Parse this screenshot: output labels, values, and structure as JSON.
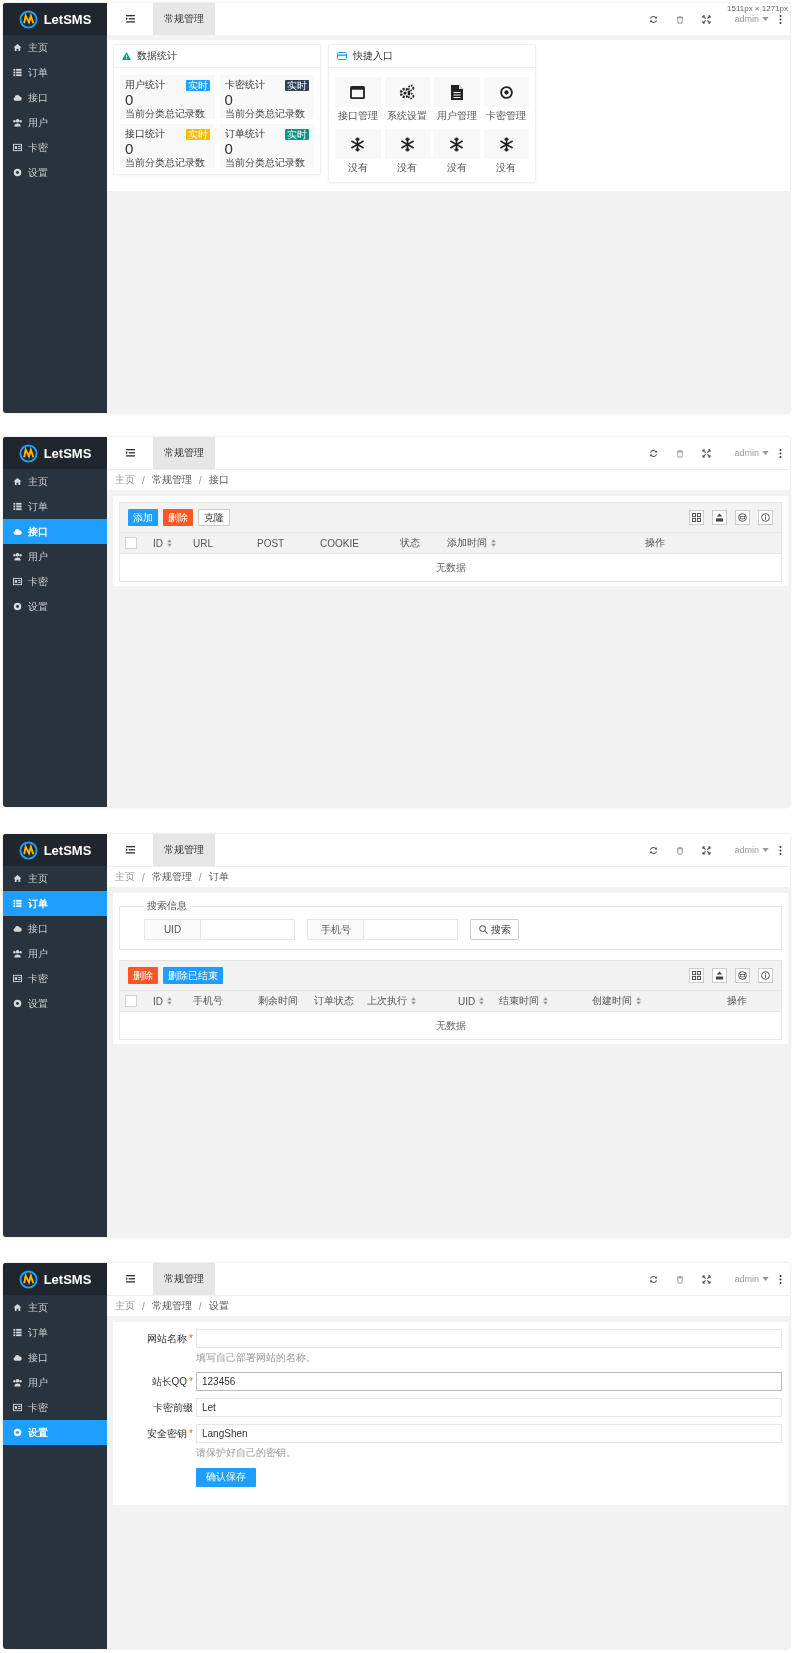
{
  "screens": [
    {
      "kind": "dashboard",
      "brand": "LetSMS",
      "size_label": "1511px × 1271px",
      "nav": [
        {
          "label": "主页",
          "selected": false
        },
        {
          "label": "订单",
          "selected": false
        },
        {
          "label": "接口",
          "selected": false
        },
        {
          "label": "用户",
          "selected": false
        },
        {
          "label": "卡密",
          "selected": false
        },
        {
          "label": "设置",
          "selected": false
        }
      ],
      "header": {
        "tab": "常规管理",
        "user": "admin"
      },
      "stats_panel": {
        "title": "数据统计",
        "tiles": [
          {
            "label": "用户统计",
            "badge": "实时",
            "color": "#1e9fff",
            "value": "0",
            "note": "当前分类总记录数"
          },
          {
            "label": "卡密统计",
            "badge": "实时",
            "color": "#2f4056",
            "value": "0",
            "note": "当前分类总记录数"
          },
          {
            "label": "接口统计",
            "badge": "实时",
            "color": "#ffb800",
            "value": "0",
            "note": "当前分类总记录数"
          },
          {
            "label": "订单统计",
            "badge": "实时",
            "color": "#009688",
            "value": "0",
            "note": "当前分类总记录数"
          }
        ]
      },
      "shortcuts_panel": {
        "title": "快捷入口",
        "items": [
          "接口管理",
          "系统设置",
          "用户管理",
          "卡密管理",
          "没有",
          "没有",
          "没有",
          "没有"
        ]
      }
    },
    {
      "kind": "table",
      "brand": "LetSMS",
      "nav": [
        {
          "label": "主页",
          "selected": false
        },
        {
          "label": "订单",
          "selected": false
        },
        {
          "label": "接口",
          "selected": true
        },
        {
          "label": "用户",
          "selected": false
        },
        {
          "label": "卡密",
          "selected": false
        },
        {
          "label": "设置",
          "selected": false
        }
      ],
      "header": {
        "tab": "常规管理",
        "user": "admin"
      },
      "breadcrumb": [
        {
          "text": "主页",
          "kind": "link"
        },
        {
          "text": "/",
          "kind": "sep"
        },
        {
          "text": "常规管理",
          "kind": "item"
        },
        {
          "text": "/",
          "kind": "sep"
        },
        {
          "text": "接口",
          "kind": "item"
        }
      ],
      "toolbar": [
        {
          "label": "添加",
          "kind": "primary"
        },
        {
          "label": "删除",
          "kind": "danger"
        },
        {
          "label": "克隆",
          "kind": "plain"
        }
      ],
      "select_all_checked": false,
      "columns": [
        {
          "label": "ID",
          "sortable": true
        },
        {
          "label": "URL",
          "sortable": false
        },
        {
          "label": "POST",
          "sortable": false
        },
        {
          "label": "COOKIE",
          "sortable": false
        },
        {
          "label": "状态",
          "sortable": false
        },
        {
          "label": "添加时间",
          "sortable": true
        },
        {
          "label": "操作",
          "sortable": false
        }
      ],
      "empty_text": "无数据"
    },
    {
      "kind": "table",
      "brand": "LetSMS",
      "nav": [
        {
          "label": "主页",
          "selected": false
        },
        {
          "label": "订单",
          "selected": true
        },
        {
          "label": "接口",
          "selected": false
        },
        {
          "label": "用户",
          "selected": false
        },
        {
          "label": "卡密",
          "selected": false
        },
        {
          "label": "设置",
          "selected": false
        }
      ],
      "header": {
        "tab": "常规管理",
        "user": "admin"
      },
      "breadcrumb": [
        {
          "text": "主页",
          "kind": "link"
        },
        {
          "text": "/",
          "kind": "sep"
        },
        {
          "text": "常规管理",
          "kind": "item"
        },
        {
          "text": "/",
          "kind": "sep"
        },
        {
          "text": "订单",
          "kind": "item"
        }
      ],
      "search": {
        "legend": "搜索信息",
        "fields": [
          {
            "label": "UID"
          },
          {
            "label": "手机号"
          }
        ],
        "button": "搜索"
      },
      "toolbar": [
        {
          "label": "删除",
          "kind": "danger"
        },
        {
          "label": "删除已结束",
          "kind": "primary"
        }
      ],
      "select_all_checked": false,
      "columns": [
        {
          "label": "ID",
          "sortable": true
        },
        {
          "label": "手机号",
          "sortable": false
        },
        {
          "label": "剩余时间",
          "sortable": false
        },
        {
          "label": "订单状态",
          "sortable": false
        },
        {
          "label": "上次执行",
          "sortable": true
        },
        {
          "label": "UID",
          "sortable": true
        },
        {
          "label": "结束时间",
          "sortable": true
        },
        {
          "label": "创建时间",
          "sortable": true
        },
        {
          "label": "操作",
          "sortable": false
        }
      ],
      "empty_text": "无数据"
    },
    {
      "kind": "form",
      "brand": "LetSMS",
      "nav": [
        {
          "label": "主页",
          "selected": false
        },
        {
          "label": "订单",
          "selected": false
        },
        {
          "label": "接口",
          "selected": false
        },
        {
          "label": "用户",
          "selected": false
        },
        {
          "label": "卡密",
          "selected": false
        },
        {
          "label": "设置",
          "selected": true
        }
      ],
      "header": {
        "tab": "常规管理",
        "user": "admin"
      },
      "breadcrumb": [
        {
          "text": "主页",
          "kind": "link"
        },
        {
          "text": "/",
          "kind": "sep"
        },
        {
          "text": "常规管理",
          "kind": "item"
        },
        {
          "text": "/",
          "kind": "sep"
        },
        {
          "text": "设置",
          "kind": "item"
        }
      ],
      "fields": [
        {
          "label": "网站名称",
          "required": true,
          "focused": false,
          "hint": "填写自己部署网站的名称。"
        },
        {
          "label": "站长QQ",
          "required": true,
          "value": "123456",
          "focused": true
        },
        {
          "label": "卡密前缀",
          "required": false,
          "value": "Let",
          "focused": false
        },
        {
          "label": "安全密钥",
          "required": true,
          "value": "LangShen",
          "focused": false,
          "hint": "请保护好自己的密钥。"
        }
      ],
      "required_mark": "*",
      "submit": "确认保存"
    }
  ]
}
